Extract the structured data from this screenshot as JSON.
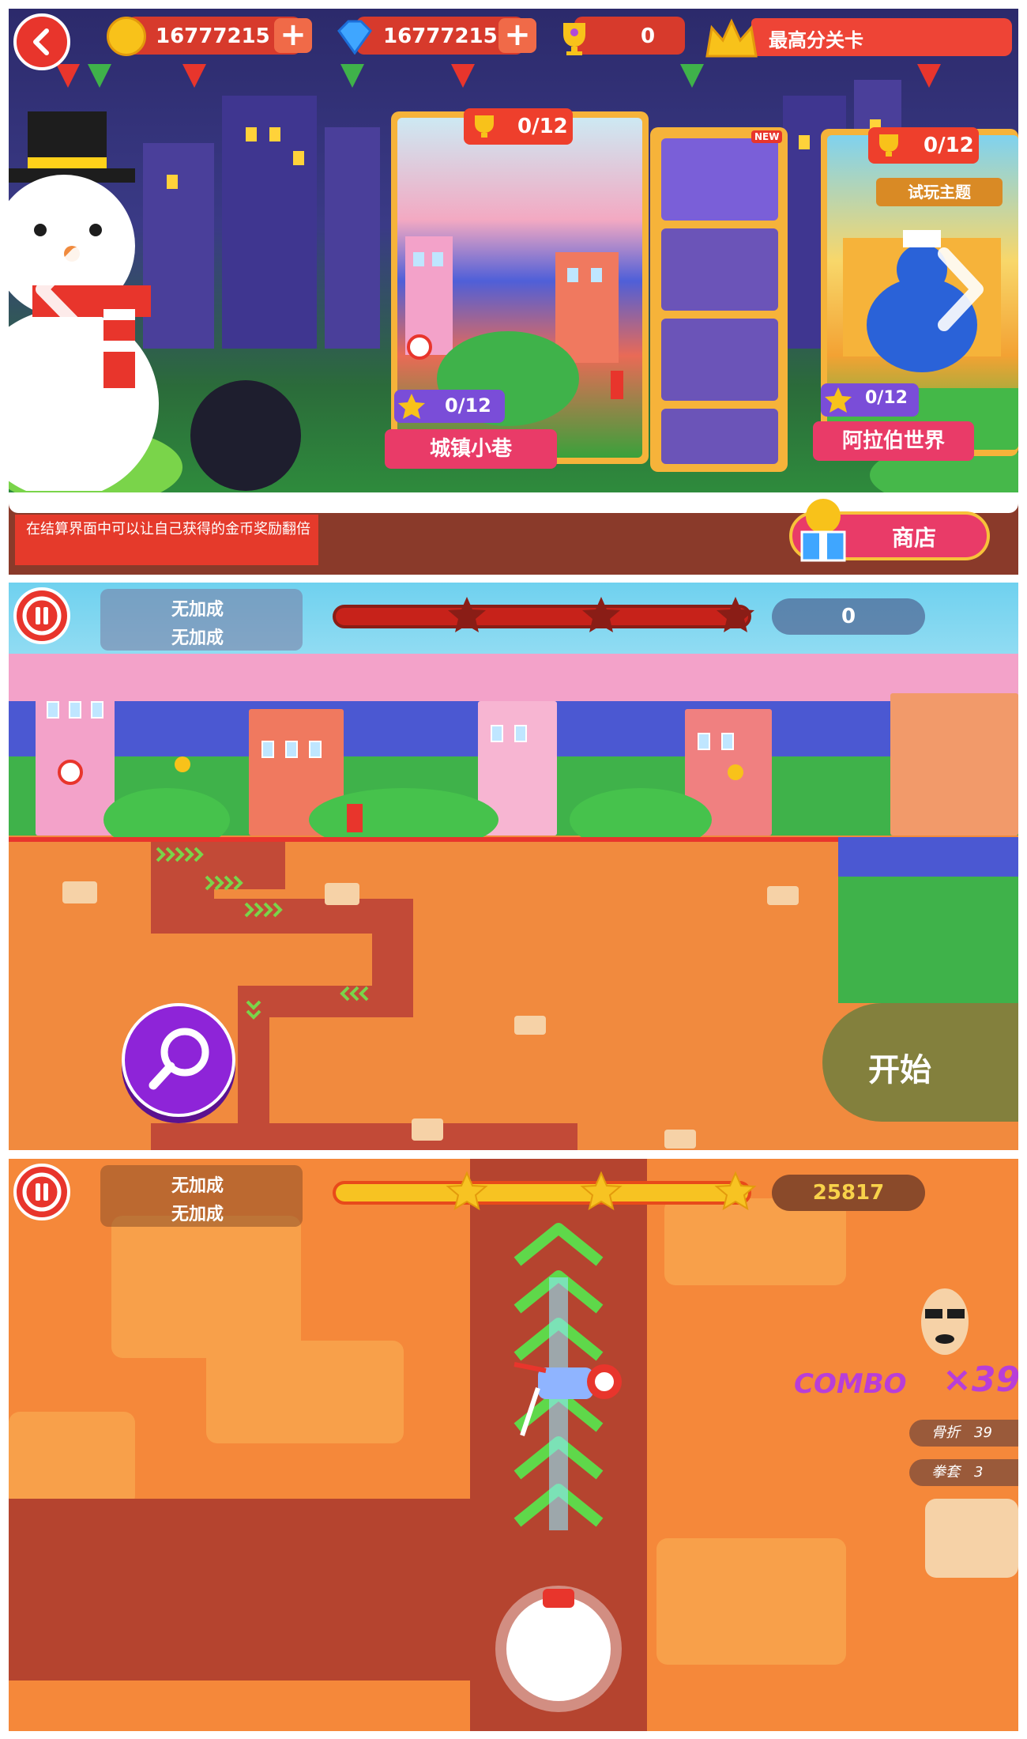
{
  "level_select": {
    "coins": "16777215",
    "gems": "16777215",
    "trophies": "0",
    "best_level_label": "最高分关卡",
    "theme_cards": [
      {
        "name": "城镇小巷",
        "trophy_progress": "0/12",
        "star_progress": "0/12"
      },
      {
        "name": "阿拉伯世界",
        "trophy_progress": "0/12",
        "star_progress": "0/12",
        "tag": "试玩主题"
      }
    ],
    "new_badge": "NEW",
    "tip": "在结算界面中可以让自己获得的金币奖励翻倍",
    "shop_label": "商店"
  },
  "planning_view": {
    "bonus_lines": [
      "无加成",
      "无加成"
    ],
    "score": "0",
    "progress_fraction": 0,
    "stars_total": 3,
    "start_label": "开始"
  },
  "action_view": {
    "bonus_lines": [
      "无加成",
      "无加成"
    ],
    "score": "25817",
    "progress_fraction": 1,
    "stars_total": 3,
    "combo_label": "COMBO",
    "combo_value": "×39",
    "stats": [
      {
        "label": "骨折",
        "value": "39"
      },
      {
        "label": "拳套",
        "value": "3"
      }
    ]
  },
  "colors": {
    "accent_red": "#e8352c",
    "coin_gold": "#f8c21a",
    "progress_yellow": "#f7c322",
    "zoom_purple": "#8e24d8",
    "combo_purple": "#b83ed8"
  }
}
